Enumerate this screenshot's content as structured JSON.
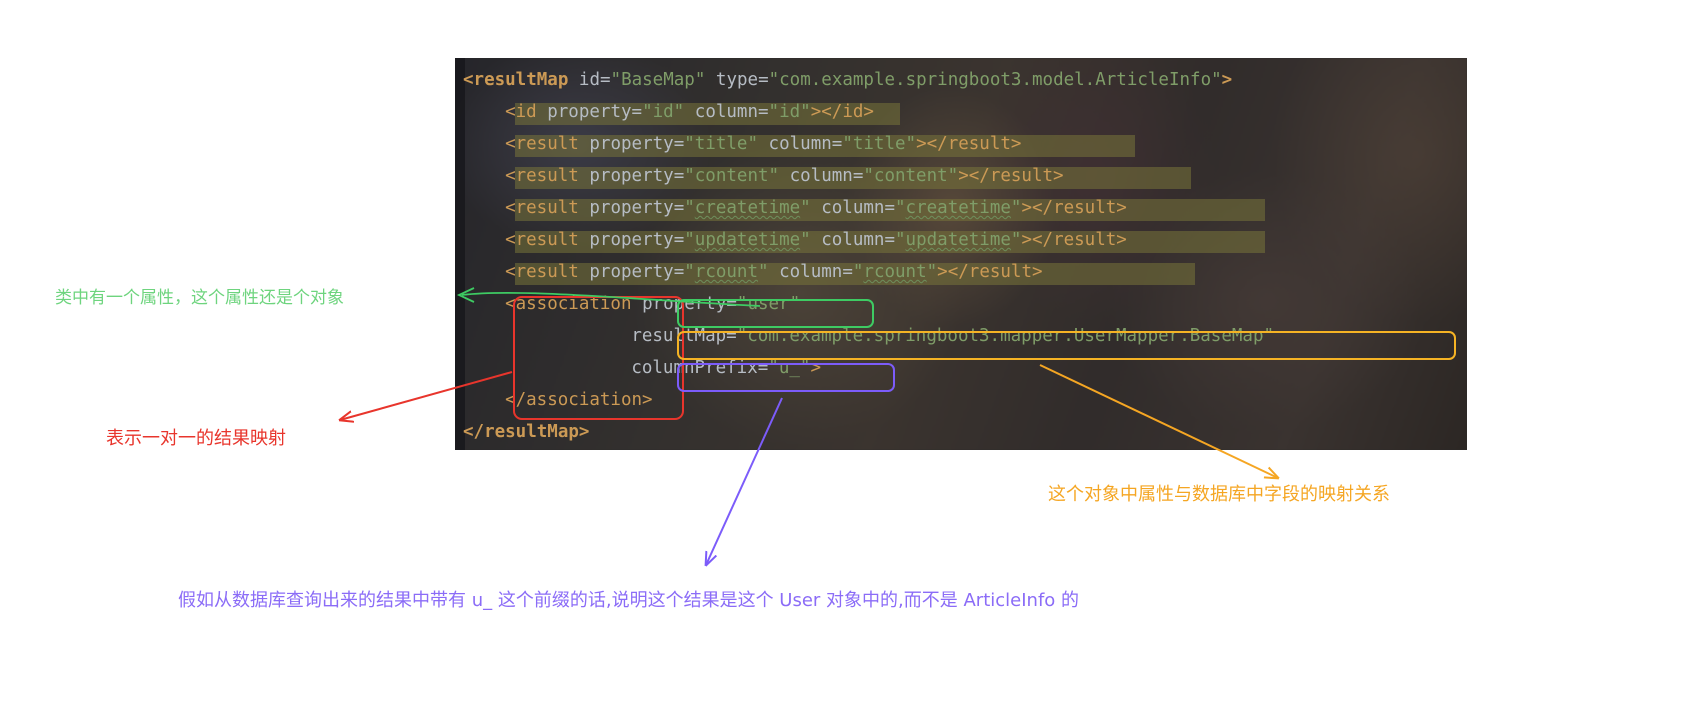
{
  "code": {
    "language": "xml",
    "lines": [
      {
        "indent": 0,
        "tokens": [
          {
            "t": "<resultMap",
            "c": "tagbold"
          },
          {
            "t": " ",
            "c": "punct"
          },
          {
            "t": "id",
            "c": "attr"
          },
          {
            "t": "=",
            "c": "eq"
          },
          {
            "t": "\"BaseMap\"",
            "c": "str"
          },
          {
            "t": " ",
            "c": "punct"
          },
          {
            "t": "type",
            "c": "attr"
          },
          {
            "t": "=",
            "c": "eq"
          },
          {
            "t": "\"com.example.springboot3.model.ArticleInfo\"",
            "c": "str"
          },
          {
            "t": ">",
            "c": "tagbold"
          }
        ]
      },
      {
        "indent": 4,
        "tokens": [
          {
            "t": "<id",
            "c": "tag"
          },
          {
            "t": " ",
            "c": "punct"
          },
          {
            "t": "property",
            "c": "attr"
          },
          {
            "t": "=",
            "c": "eq"
          },
          {
            "t": "\"id\"",
            "c": "str"
          },
          {
            "t": " ",
            "c": "punct"
          },
          {
            "t": "column",
            "c": "attr"
          },
          {
            "t": "=",
            "c": "eq"
          },
          {
            "t": "\"id\"",
            "c": "str"
          },
          {
            "t": ">",
            "c": "tag"
          },
          {
            "t": "</id>",
            "c": "tag"
          }
        ]
      },
      {
        "indent": 4,
        "tokens": [
          {
            "t": "<result",
            "c": "tag"
          },
          {
            "t": " ",
            "c": "punct"
          },
          {
            "t": "property",
            "c": "attr"
          },
          {
            "t": "=",
            "c": "eq"
          },
          {
            "t": "\"title\"",
            "c": "str"
          },
          {
            "t": " ",
            "c": "punct"
          },
          {
            "t": "column",
            "c": "attr"
          },
          {
            "t": "=",
            "c": "eq"
          },
          {
            "t": "\"title\"",
            "c": "str"
          },
          {
            "t": ">",
            "c": "tag"
          },
          {
            "t": "</result>",
            "c": "tag"
          }
        ]
      },
      {
        "indent": 4,
        "tokens": [
          {
            "t": "<result",
            "c": "tag"
          },
          {
            "t": " ",
            "c": "punct"
          },
          {
            "t": "property",
            "c": "attr"
          },
          {
            "t": "=",
            "c": "eq"
          },
          {
            "t": "\"content\"",
            "c": "str"
          },
          {
            "t": " ",
            "c": "punct"
          },
          {
            "t": "column",
            "c": "attr"
          },
          {
            "t": "=",
            "c": "eq"
          },
          {
            "t": "\"content\"",
            "c": "str"
          },
          {
            "t": ">",
            "c": "tag"
          },
          {
            "t": "</result>",
            "c": "tag"
          }
        ]
      },
      {
        "indent": 4,
        "tokens": [
          {
            "t": "<result",
            "c": "tag"
          },
          {
            "t": " ",
            "c": "punct"
          },
          {
            "t": "property",
            "c": "attr"
          },
          {
            "t": "=",
            "c": "eq"
          },
          {
            "t": "\"",
            "c": "str"
          },
          {
            "t": "createtime",
            "c": "str wavy"
          },
          {
            "t": "\"",
            "c": "str"
          },
          {
            "t": " ",
            "c": "punct"
          },
          {
            "t": "column",
            "c": "attr"
          },
          {
            "t": "=",
            "c": "eq"
          },
          {
            "t": "\"",
            "c": "str"
          },
          {
            "t": "createtime",
            "c": "str wavy"
          },
          {
            "t": "\"",
            "c": "str"
          },
          {
            "t": ">",
            "c": "tag"
          },
          {
            "t": "</result>",
            "c": "tag"
          }
        ]
      },
      {
        "indent": 4,
        "tokens": [
          {
            "t": "<result",
            "c": "tag"
          },
          {
            "t": " ",
            "c": "punct"
          },
          {
            "t": "property",
            "c": "attr"
          },
          {
            "t": "=",
            "c": "eq"
          },
          {
            "t": "\"",
            "c": "str"
          },
          {
            "t": "updatetime",
            "c": "str wavy"
          },
          {
            "t": "\"",
            "c": "str"
          },
          {
            "t": " ",
            "c": "punct"
          },
          {
            "t": "column",
            "c": "attr"
          },
          {
            "t": "=",
            "c": "eq"
          },
          {
            "t": "\"",
            "c": "str"
          },
          {
            "t": "updatetime",
            "c": "str wavy"
          },
          {
            "t": "\"",
            "c": "str"
          },
          {
            "t": ">",
            "c": "tag"
          },
          {
            "t": "</result>",
            "c": "tag"
          }
        ]
      },
      {
        "indent": 4,
        "tokens": [
          {
            "t": "<result",
            "c": "tag"
          },
          {
            "t": " ",
            "c": "punct"
          },
          {
            "t": "property",
            "c": "attr"
          },
          {
            "t": "=",
            "c": "eq"
          },
          {
            "t": "\"",
            "c": "str"
          },
          {
            "t": "rcount",
            "c": "str wavy"
          },
          {
            "t": "\"",
            "c": "str"
          },
          {
            "t": " ",
            "c": "punct"
          },
          {
            "t": "column",
            "c": "attr"
          },
          {
            "t": "=",
            "c": "eq"
          },
          {
            "t": "\"",
            "c": "str"
          },
          {
            "t": "rcount",
            "c": "str wavy"
          },
          {
            "t": "\"",
            "c": "str"
          },
          {
            "t": ">",
            "c": "tag"
          },
          {
            "t": "</result>",
            "c": "tag"
          }
        ]
      },
      {
        "indent": 4,
        "tokens": [
          {
            "t": "<association",
            "c": "tag"
          },
          {
            "t": " ",
            "c": "punct"
          },
          {
            "t": "property",
            "c": "attr"
          },
          {
            "t": "=",
            "c": "eq"
          },
          {
            "t": "\"user\"",
            "c": "str"
          }
        ]
      },
      {
        "indent": 16,
        "tokens": [
          {
            "t": "resultMap",
            "c": "attr"
          },
          {
            "t": "=",
            "c": "eq"
          },
          {
            "t": "\"com.example.springboot3.mapper.UserMapper.BaseMap\"",
            "c": "str"
          }
        ]
      },
      {
        "indent": 16,
        "tokens": [
          {
            "t": "columnPrefix",
            "c": "attr"
          },
          {
            "t": "=",
            "c": "eq"
          },
          {
            "t": "\"u_\"",
            "c": "str"
          },
          {
            "t": ">",
            "c": "tag"
          }
        ]
      },
      {
        "indent": 4,
        "tokens": [
          {
            "t": "</association>",
            "c": "tag"
          }
        ]
      },
      {
        "indent": 0,
        "tokens": [
          {
            "t": "</resultMap>",
            "c": "tagbold"
          }
        ]
      }
    ]
  },
  "annotations": {
    "green": {
      "label": "类中有一个属性，这个属性还是个对象",
      "color": "#6ed47e",
      "box_target": "property=\"user\""
    },
    "red": {
      "label": "表示一对一的结果映射",
      "color": "#e8352c",
      "box_target": "<association> ... </association>"
    },
    "orange": {
      "label": "这个对象中属性与数据库中字段的映射关系",
      "color": "#f5a623",
      "box_target": "resultMap=\"com.example.springboot3.mapper.UserMapper.BaseMap\""
    },
    "purple": {
      "label": "假如从数据库查询出来的结果中带有 u_ 这个前缀的话,说明这个结果是这个 User 对象中的,而不是 ArticleInfo 的",
      "color": "#8b6cf7",
      "box_target": "columnPrefix=\"u_\""
    }
  }
}
